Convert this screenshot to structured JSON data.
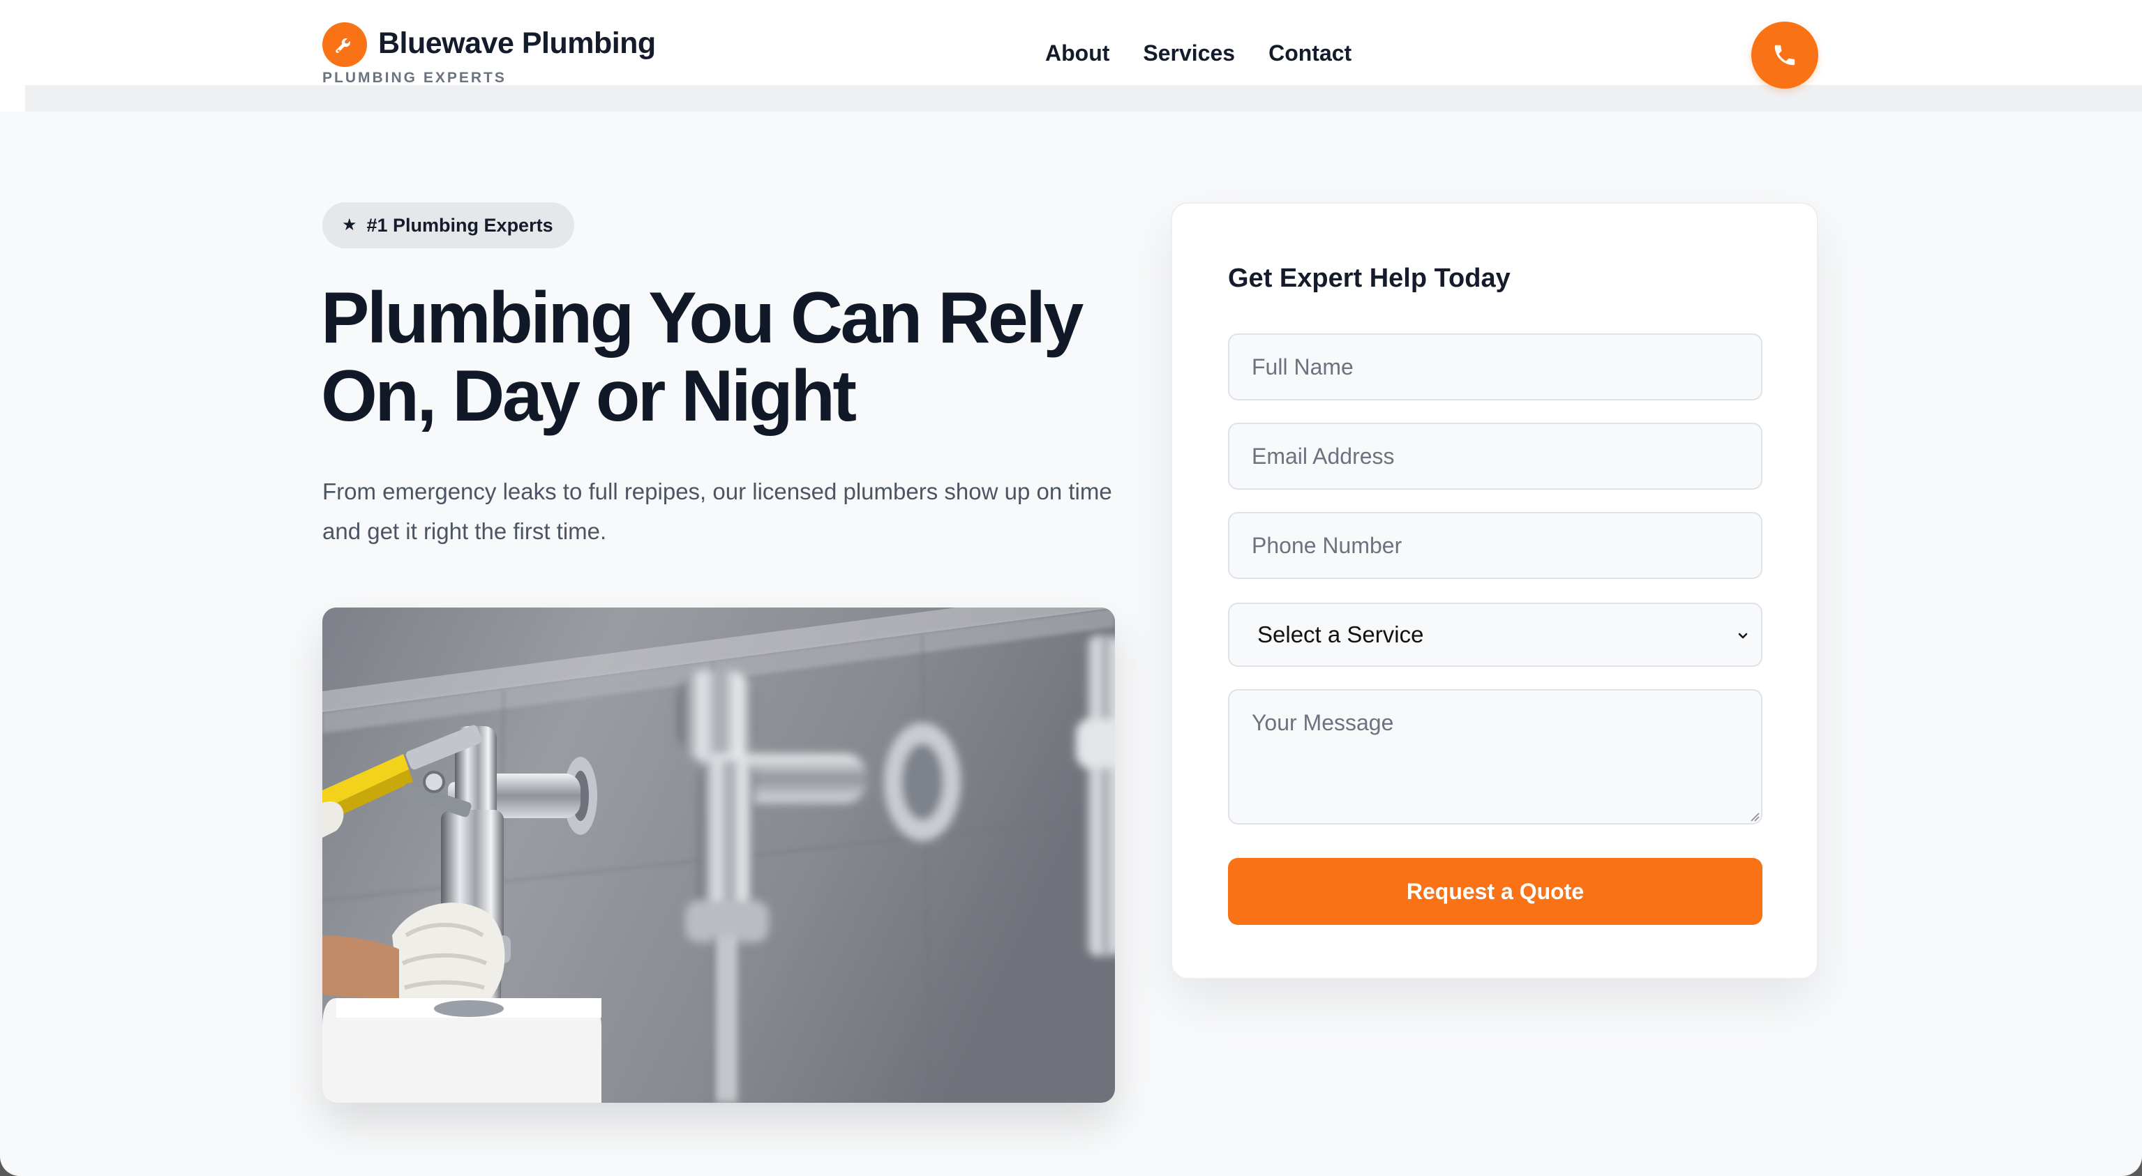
{
  "brand": {
    "name": "Bluewave Plumbing",
    "tagline": "PLUMBING EXPERTS",
    "logo_icon": "wrench-icon",
    "accent_color": "#f97316"
  },
  "nav": {
    "items": [
      {
        "label": "About"
      },
      {
        "label": "Services"
      },
      {
        "label": "Contact"
      }
    ],
    "call_icon": "phone-icon"
  },
  "hero": {
    "badge": "#1 Plumbing Experts",
    "badge_icon": "star-icon",
    "headline_line1": "Plumbing You Can Rely",
    "headline_line2": "On, Day or Night",
    "subtext": "From emergency leaks to full repipes, our licensed plumbers show up on time and get it right the first time.",
    "image": "photo-plumber-fixing-urinal-flush-valve"
  },
  "form": {
    "title": "Get Expert Help Today",
    "full_name_placeholder": "Full Name",
    "email_placeholder": "Email Address",
    "phone_placeholder": "Phone Number",
    "service_selected": "Select a Service",
    "message_placeholder": "Your Message",
    "submit_label": "Request a Quote"
  }
}
